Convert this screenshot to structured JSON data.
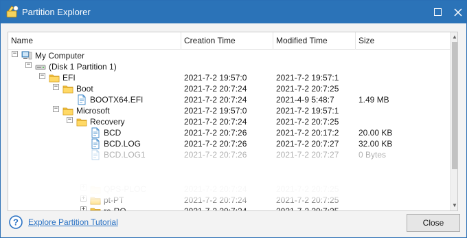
{
  "window": {
    "title": "Partition Explorer"
  },
  "columns": {
    "name": "Name",
    "creation_time": "Creation Time",
    "modified_time": "Modified Time",
    "size": "Size"
  },
  "tree": [
    {
      "label": "My Computer",
      "creation": "",
      "modified": "",
      "size": "",
      "icon": "computer-icon",
      "expander": "−"
    },
    {
      "label": "(Disk 1 Partition 1)",
      "creation": "",
      "modified": "",
      "size": "",
      "icon": "drive-icon",
      "expander": "−"
    },
    {
      "label": "EFI",
      "creation": "2021-7-2 19:57:0",
      "modified": "2021-7-2 19:57:1",
      "size": "",
      "icon": "folder-icon",
      "expander": "−"
    },
    {
      "label": "Boot",
      "creation": "2021-7-2 20:7:24",
      "modified": "2021-7-2 20:7:25",
      "size": "",
      "icon": "folder-icon",
      "expander": "−"
    },
    {
      "label": "BOOTX64.EFI",
      "creation": "2021-7-2 20:7:24",
      "modified": "2021-4-9 5:48:7",
      "size": "1.49 MB",
      "icon": "file-icon",
      "expander": ""
    },
    {
      "label": "Microsoft",
      "creation": "2021-7-2 19:57:0",
      "modified": "2021-7-2 19:57:1",
      "size": "",
      "icon": "folder-icon",
      "expander": "−"
    },
    {
      "label": "Recovery",
      "creation": "2021-7-2 20:7:24",
      "modified": "2021-7-2 20:7:25",
      "size": "",
      "icon": "folder-icon",
      "expander": "−"
    },
    {
      "label": "BCD",
      "creation": "2021-7-2 20:7:26",
      "modified": "2021-7-2 20:17:2",
      "size": "20.00 KB",
      "icon": "file-icon",
      "expander": ""
    },
    {
      "label": "BCD.LOG",
      "creation": "2021-7-2 20:7:26",
      "modified": "2021-7-2 20:7:27",
      "size": "32.00 KB",
      "icon": "file-icon",
      "expander": ""
    },
    {
      "label": "BCD.LOG1",
      "creation": "2021-7-2 20:7:26",
      "modified": "2021-7-2 20:7:27",
      "size": "0 Bytes",
      "icon": "file-icon",
      "expander": ""
    },
    {
      "label": "QPS-PLOC",
      "creation": "2021-7-2 20:7:24",
      "modified": "2021-7-2 20:7:25",
      "size": "",
      "icon": "folder-icon",
      "expander": "+"
    },
    {
      "label": "pt-PT",
      "creation": "2021-7-2 20:7:24",
      "modified": "2021-7-2 20:7:25",
      "size": "",
      "icon": "folder-icon",
      "expander": "+"
    },
    {
      "label": "ro-RO",
      "creation": "2021-7-2 20:7:24",
      "modified": "2021-7-2 20:7:25",
      "size": "",
      "icon": "folder-icon",
      "expander": "+"
    }
  ],
  "footer": {
    "help_link": "Explore Partition Tutorial",
    "close_label": "Close"
  },
  "colors": {
    "titlebar": "#2b73b8",
    "link": "#2a72c4",
    "folder": "#f5c542"
  }
}
